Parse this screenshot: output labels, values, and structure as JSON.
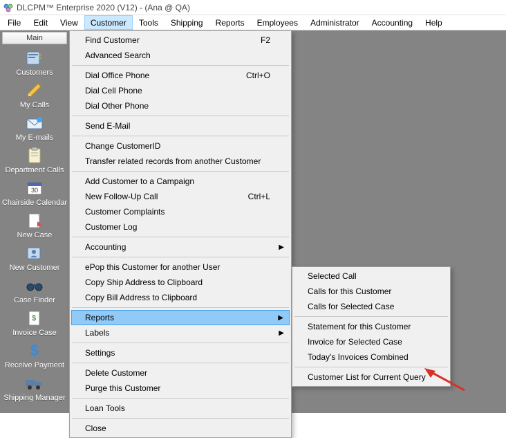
{
  "title": "DLCPM™ Enterprise 2020 (V12) - (Ana @ QA)",
  "menubar": {
    "file": "File",
    "edit": "Edit",
    "view": "View",
    "customer": "Customer",
    "tools": "Tools",
    "shipping": "Shipping",
    "reports": "Reports",
    "employees": "Employees",
    "administrator": "Administrator",
    "accounting": "Accounting",
    "help": "Help"
  },
  "sidebar": {
    "header": "Main",
    "items": [
      {
        "label": "Customers"
      },
      {
        "label": "My Calls"
      },
      {
        "label": "My E-mails"
      },
      {
        "label": "Department Calls"
      },
      {
        "label": "Chairside Calendar"
      },
      {
        "label": "New Case"
      },
      {
        "label": "New Customer"
      },
      {
        "label": "Case Finder"
      },
      {
        "label": "Invoice Case"
      },
      {
        "label": "Receive Payment"
      },
      {
        "label": "Shipping Manager"
      }
    ]
  },
  "customer_menu": {
    "find_customer": "Find Customer",
    "find_customer_sc": "F2",
    "advanced_search": "Advanced Search",
    "dial_office": "Dial Office Phone",
    "dial_office_sc": "Ctrl+O",
    "dial_cell": "Dial Cell Phone",
    "dial_other": "Dial Other Phone",
    "send_email": "Send E-Mail",
    "change_id": "Change CustomerID",
    "transfer": "Transfer related records from another Customer",
    "add_campaign": "Add Customer to a Campaign",
    "new_followup": "New Follow-Up Call",
    "new_followup_sc": "Ctrl+L",
    "complaints": "Customer Complaints",
    "log": "Customer Log",
    "accounting": "Accounting",
    "epop": "ePop this Customer for another User",
    "copy_ship": "Copy Ship Address to Clipboard",
    "copy_bill": "Copy Bill Address to Clipboard",
    "reports": "Reports",
    "labels": "Labels",
    "settings": "Settings",
    "delete": "Delete Customer",
    "purge": "Purge this Customer",
    "loan_tools": "Loan Tools",
    "close": "Close"
  },
  "reports_submenu": {
    "selected_call": "Selected Call",
    "calls_customer": "Calls for this Customer",
    "calls_case": "Calls for Selected Case",
    "statement": "Statement for this Customer",
    "invoice_case": "Invoice for Selected Case",
    "invoices_combined": "Today's Invoices Combined",
    "customer_list": "Customer List for Current Query"
  }
}
